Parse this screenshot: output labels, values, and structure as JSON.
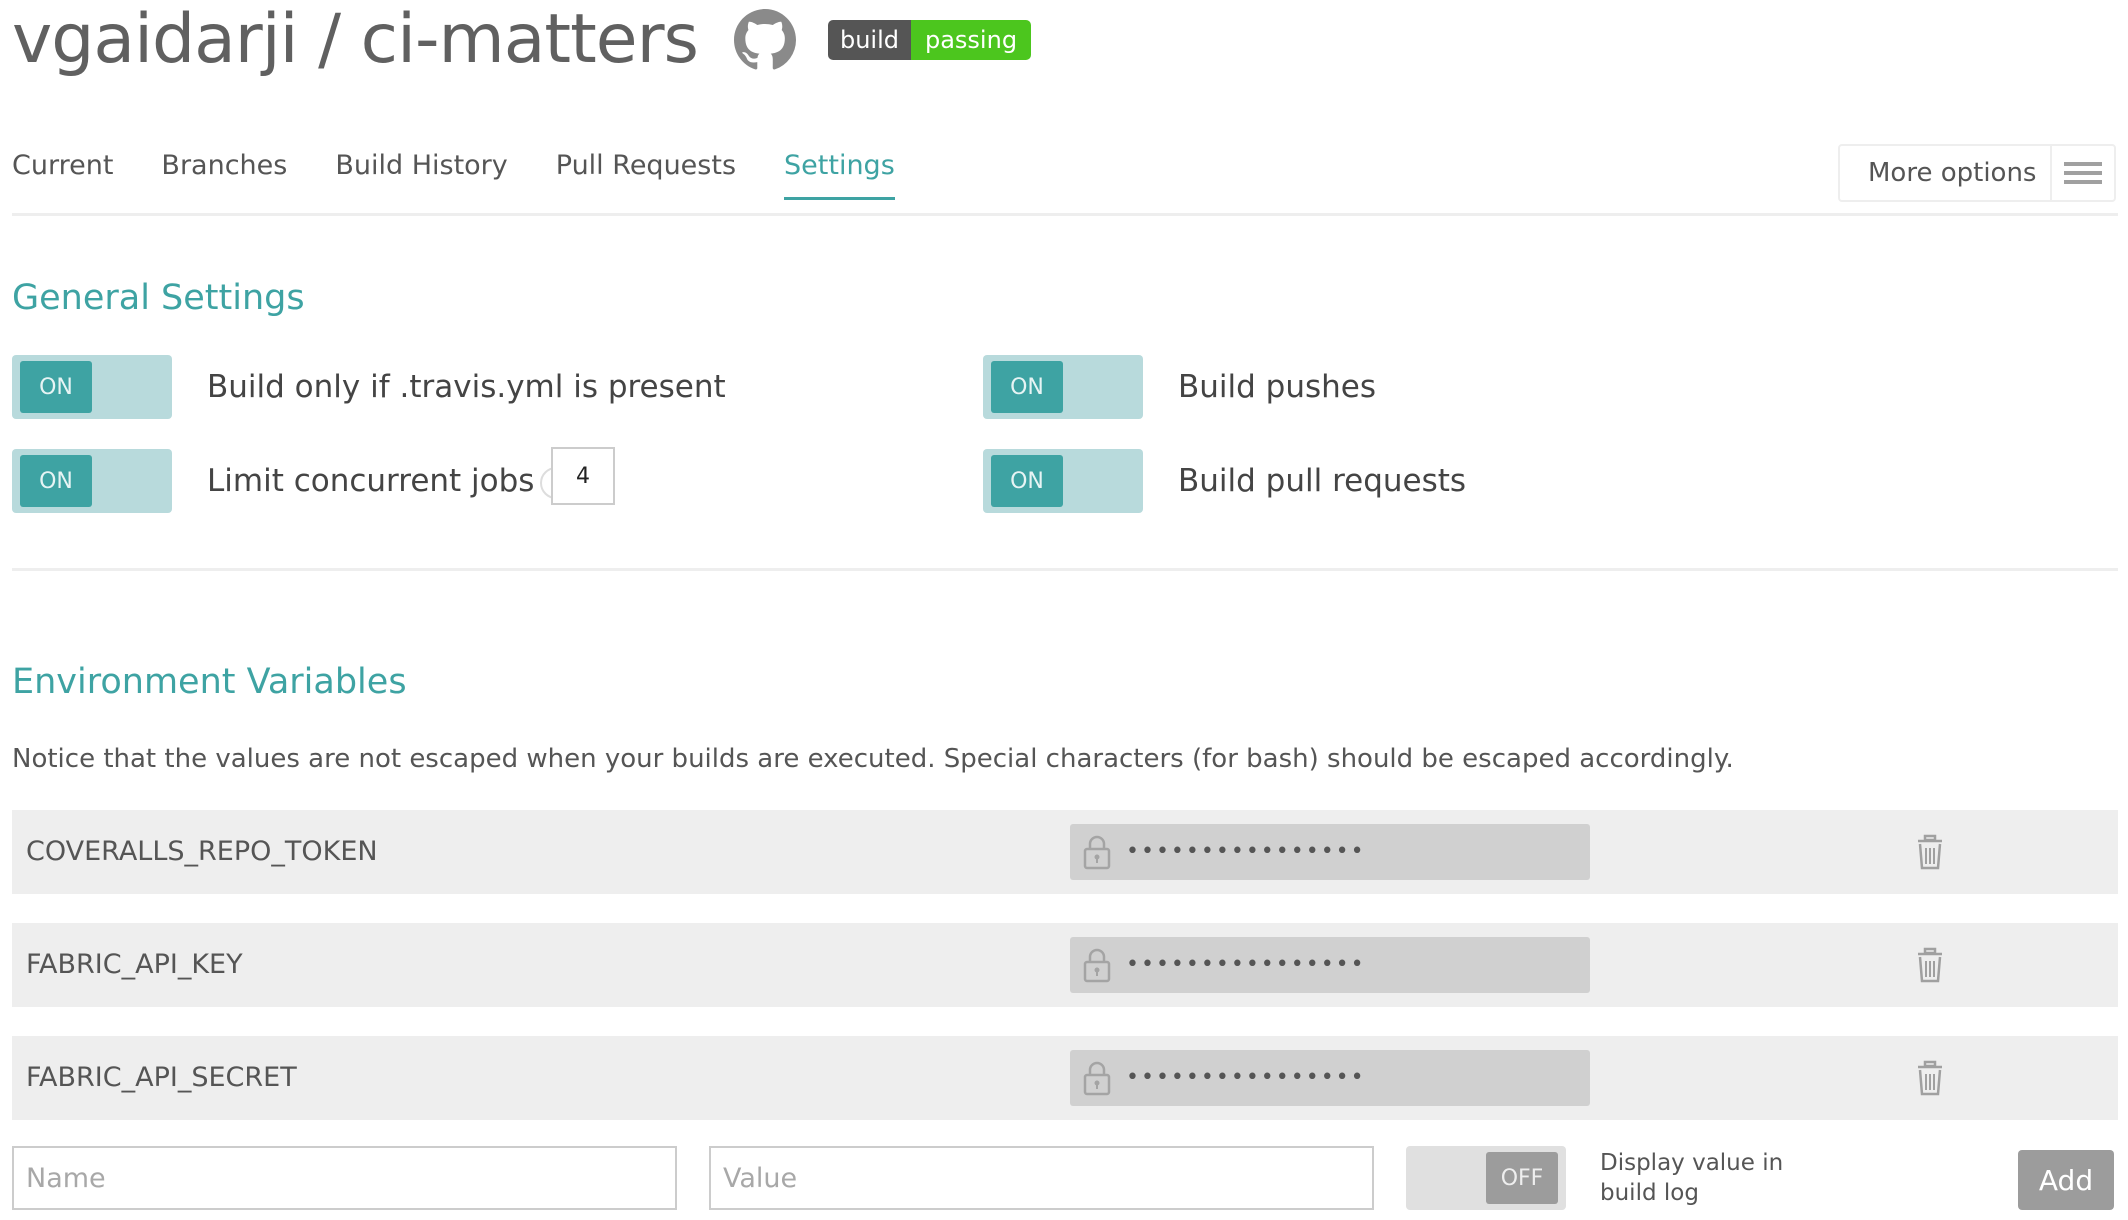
{
  "header": {
    "repo_title": "vgaidarji / ci-matters",
    "badge_left": "build",
    "badge_right": "passing",
    "badge_colors": {
      "left": "#555555",
      "right": "#4cc61e"
    }
  },
  "tabs": [
    {
      "label": "Current",
      "active": false
    },
    {
      "label": "Branches",
      "active": false
    },
    {
      "label": "Build History",
      "active": false
    },
    {
      "label": "Pull Requests",
      "active": false
    },
    {
      "label": "Settings",
      "active": true
    }
  ],
  "more_options": {
    "label": "More options",
    "icon": "hamburger-menu-icon"
  },
  "general": {
    "heading": "General Settings",
    "settings": [
      {
        "label": "Build only if .travis.yml is present",
        "state": "ON"
      },
      {
        "label": "Build pushes",
        "state": "ON"
      },
      {
        "label": "Limit concurrent jobs",
        "state": "ON",
        "help": "?",
        "value": "4"
      },
      {
        "label": "Build pull requests",
        "state": "ON"
      }
    ]
  },
  "env": {
    "heading": "Environment Variables",
    "notice": "Notice that the values are not escaped when your builds are executed. Special characters (for bash) should be escaped accordingly.",
    "variables": [
      {
        "name": "COVERALLS_REPO_TOKEN",
        "value": "••••••••••••••••"
      },
      {
        "name": "FABRIC_API_KEY",
        "value": "••••••••••••••••"
      },
      {
        "name": "FABRIC_API_SECRET",
        "value": "••••••••••••••••"
      }
    ],
    "add_form": {
      "name_placeholder": "Name",
      "value_placeholder": "Value",
      "display_toggle_state": "OFF",
      "display_label": "Display value in build log",
      "add_label": "Add"
    }
  },
  "colors": {
    "accent": "#3ea3a3",
    "toggle_track": "#b8dadc",
    "row_bg": "#eeeeee"
  }
}
